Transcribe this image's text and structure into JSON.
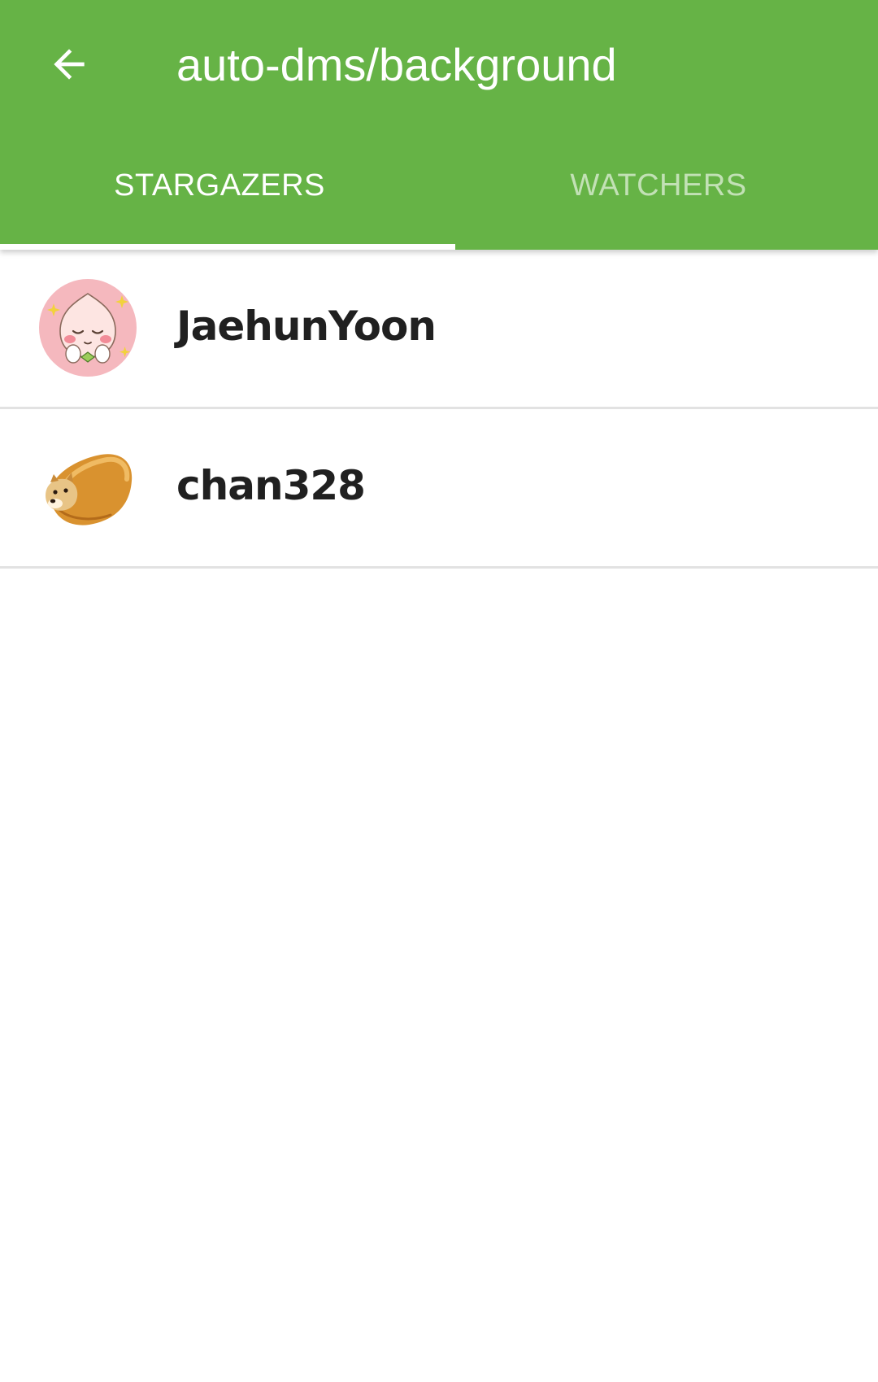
{
  "toolbar": {
    "title": "auto-dms/background",
    "back_icon": "arrow-left-icon"
  },
  "tabs": [
    {
      "label": "STARGAZERS",
      "active": true
    },
    {
      "label": "WATCHERS",
      "active": false
    }
  ],
  "users": [
    {
      "username": "JaehunYoon",
      "avatar_icon": "peach-character-avatar"
    },
    {
      "username": "chan328",
      "avatar_icon": "doge-bread-avatar"
    }
  ],
  "colors": {
    "primary": "#66b346",
    "text": "#202020",
    "divider": "#e2e2e2"
  }
}
